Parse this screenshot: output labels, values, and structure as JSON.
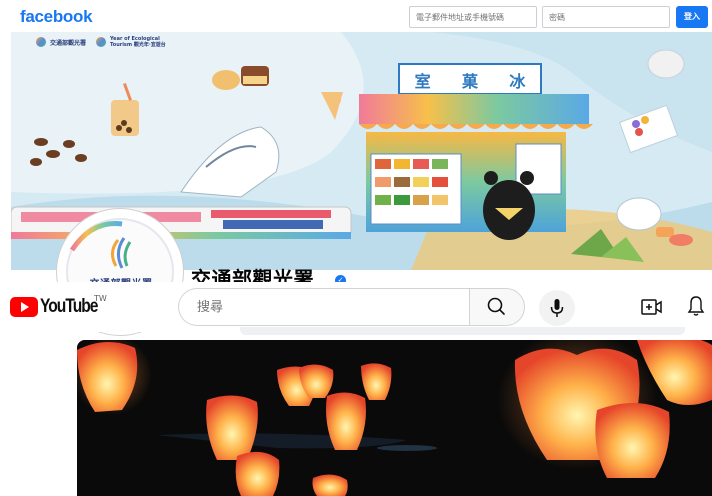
{
  "facebook": {
    "logo_text": "facebook",
    "email_placeholder": "電子郵件地址或手機號碼",
    "password_placeholder": "密碼",
    "login_label": "登入",
    "brand_color": "#1877f2"
  },
  "cover": {
    "top_logos": [
      "交通部觀光署",
      "Year of Ecological Tourism 觀光年·宜遊台"
    ],
    "shop_sign": [
      "室",
      "菓",
      "冰"
    ]
  },
  "page": {
    "name": "交通部觀光署",
    "profile_logo_text": "交通部觀光署",
    "verified_icon": "verified-badge-icon"
  },
  "youtube": {
    "logo_text": "YouTube",
    "region": "TW",
    "search_placeholder": "搜尋",
    "search_icon": "search-icon",
    "mic_icon": "microphone-icon",
    "create_icon": "create-video-icon",
    "bell_icon": "notifications-bell-icon",
    "brand_color": "#ff0000"
  },
  "video": {
    "subject": "sky lanterns"
  }
}
